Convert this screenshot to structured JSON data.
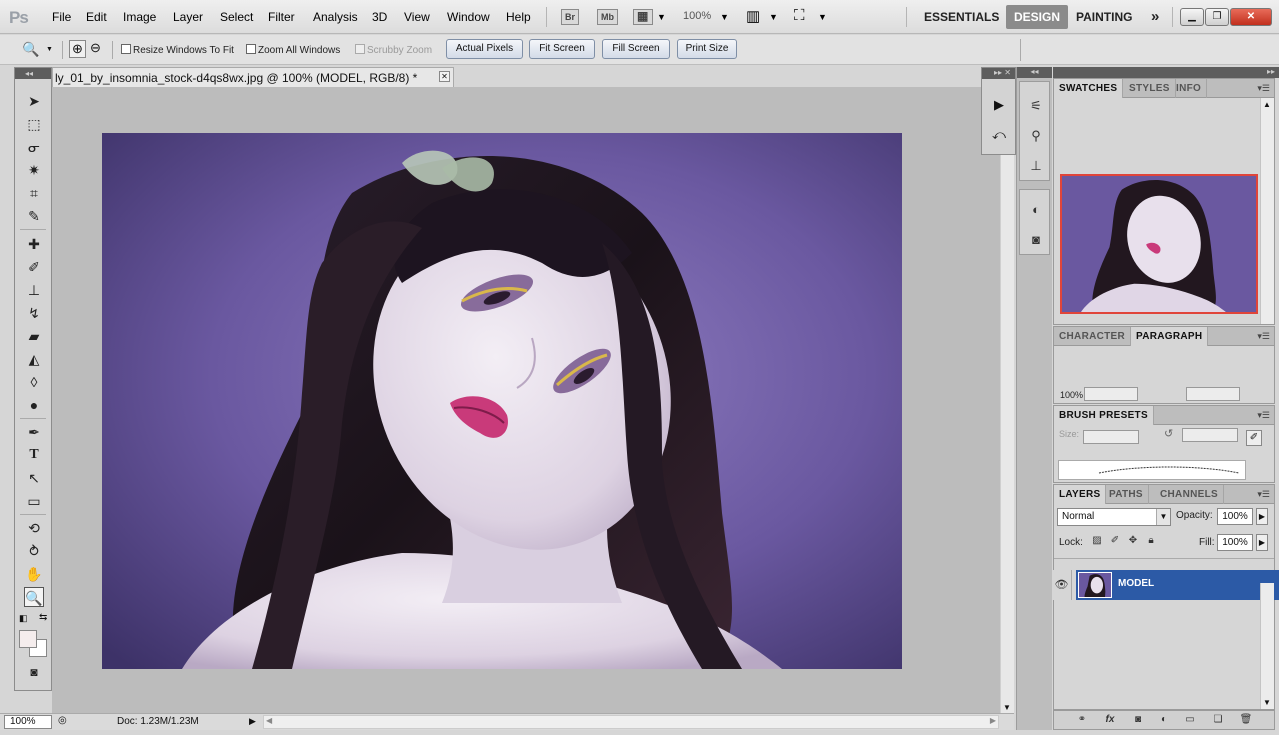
{
  "app": {
    "logo": "Ps",
    "menu": [
      "File",
      "Edit",
      "Image",
      "Layer",
      "Select",
      "Filter",
      "Analysis",
      "3D",
      "View",
      "Window",
      "Help"
    ],
    "bridge_label": "Br",
    "minibridge_label": "Mb",
    "zoom_level": "100%",
    "workspaces": [
      "ESSENTIALS",
      "DESIGN",
      "PAINTING"
    ],
    "active_workspace": "DESIGN",
    "more_workspaces": "»"
  },
  "options_bar": {
    "resize_windows_to_fit": "Resize Windows To Fit",
    "zoom_all_windows": "Zoom All Windows",
    "scrubby_zoom": "Scrubby Zoom",
    "actual_pixels": "Actual Pixels",
    "fit_screen": "Fit Screen",
    "fill_screen": "Fill Screen",
    "print_size": "Print Size"
  },
  "document": {
    "tab_title": "ly_01_by_insomnia_stock-d4qs8wx.jpg @ 100% (MODEL, RGB/8) *",
    "status_zoom": "100%",
    "status_doc": "Doc: 1.23M/1.23M"
  },
  "panels": {
    "swatches_group": [
      "SWATCHES",
      "STYLES",
      "INFO"
    ],
    "character_group": [
      "CHARACTER",
      "PARAGRAPH"
    ],
    "character_zoom": "100%",
    "brush_presets": "BRUSH PRESETS",
    "brush_size_label": "Size:",
    "layers_group": [
      "LAYERS",
      "PATHS",
      "CHANNELS"
    ],
    "blend_mode": "Normal",
    "opacity_label": "Opacity:",
    "opacity_value": "100%",
    "lock_label": "Lock:",
    "fill_label": "Fill:",
    "fill_value": "100%",
    "layer_name": "MODEL"
  },
  "colors": {
    "accent_selection": "#2c5aa6",
    "navigator_frame": "#e0453a",
    "close_button": "#c9371f",
    "photo_background": "#5a4a8c"
  },
  "icons": {
    "tools": [
      "move-icon",
      "marquee-icon",
      "lasso-icon",
      "quick-select-icon",
      "crop-icon",
      "eyedropper-icon",
      "healing-icon",
      "brush-icon",
      "stamp-icon",
      "history-brush-icon",
      "eraser-icon",
      "paint-bucket-icon",
      "blur-icon",
      "dodge-icon",
      "pen-icon",
      "type-icon",
      "path-select-icon",
      "shape-icon",
      "3d-rotate-icon",
      "3d-orbit-icon",
      "hand-icon",
      "zoom-icon"
    ]
  }
}
